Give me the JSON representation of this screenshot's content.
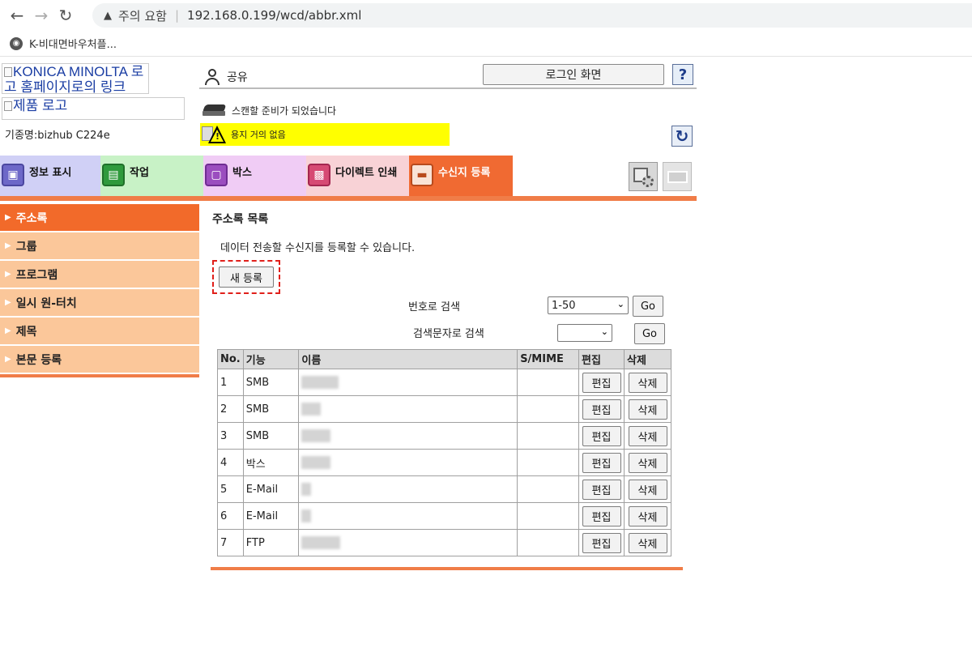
{
  "browser": {
    "security_label": "주의 요함",
    "url": "192.168.0.199/wcd/abbr.xml",
    "bookmark": "K-비대면바우처플..."
  },
  "header": {
    "logo_alt": "KONICA MINOLTA 로고 홈페이지로의 링크",
    "product_logo_alt": "제품 로고",
    "model": "기종명:bizhub C224e",
    "user": "공유",
    "login_button": "로그인 화면",
    "help": "?",
    "scan_status": "스캔할 준비가 되었습니다",
    "paper_warning": "용지 거의 없음"
  },
  "tabs": [
    {
      "label": "정보 표시"
    },
    {
      "label": "작업"
    },
    {
      "label": "박스"
    },
    {
      "label": "다이렉트 인쇄"
    },
    {
      "label": "수신지 등록"
    }
  ],
  "sidebar": {
    "items": [
      {
        "label": "주소록"
      },
      {
        "label": "그룹"
      },
      {
        "label": "프로그램"
      },
      {
        "label": "일시 원-터치"
      },
      {
        "label": "제목"
      },
      {
        "label": "본문 등록"
      }
    ]
  },
  "main": {
    "title": "주소록 목록",
    "description": "데이터 전송할 수신지를 등록할 수 있습니다.",
    "new_button": "새 등록",
    "search_by_number": "번호로 검색",
    "number_selected": "1-50",
    "search_by_text": "검색문자로 검색",
    "text_selected": "",
    "go_label": "Go"
  },
  "table": {
    "headers": {
      "no": "No.",
      "function": "기능",
      "name": "이름",
      "smime": "S/MIME",
      "edit": "편집",
      "delete": "삭제"
    },
    "rows": [
      {
        "no": "1",
        "function": "SMB",
        "edit": "편집",
        "delete": "삭제"
      },
      {
        "no": "2",
        "function": "SMB",
        "edit": "편집",
        "delete": "삭제"
      },
      {
        "no": "3",
        "function": "SMB",
        "edit": "편집",
        "delete": "삭제"
      },
      {
        "no": "4",
        "function": "박스",
        "edit": "편집",
        "delete": "삭제"
      },
      {
        "no": "5",
        "function": "E-Mail",
        "edit": "편집",
        "delete": "삭제"
      },
      {
        "no": "6",
        "function": "E-Mail",
        "edit": "편집",
        "delete": "삭제"
      },
      {
        "no": "7",
        "function": "FTP",
        "edit": "편집",
        "delete": "삭제"
      }
    ]
  },
  "colors": {
    "accent": "#f06a32",
    "sidebar_bg": "#fbc79a",
    "warning_bg": "#ffff00",
    "highlight_border": "#e0201b"
  }
}
